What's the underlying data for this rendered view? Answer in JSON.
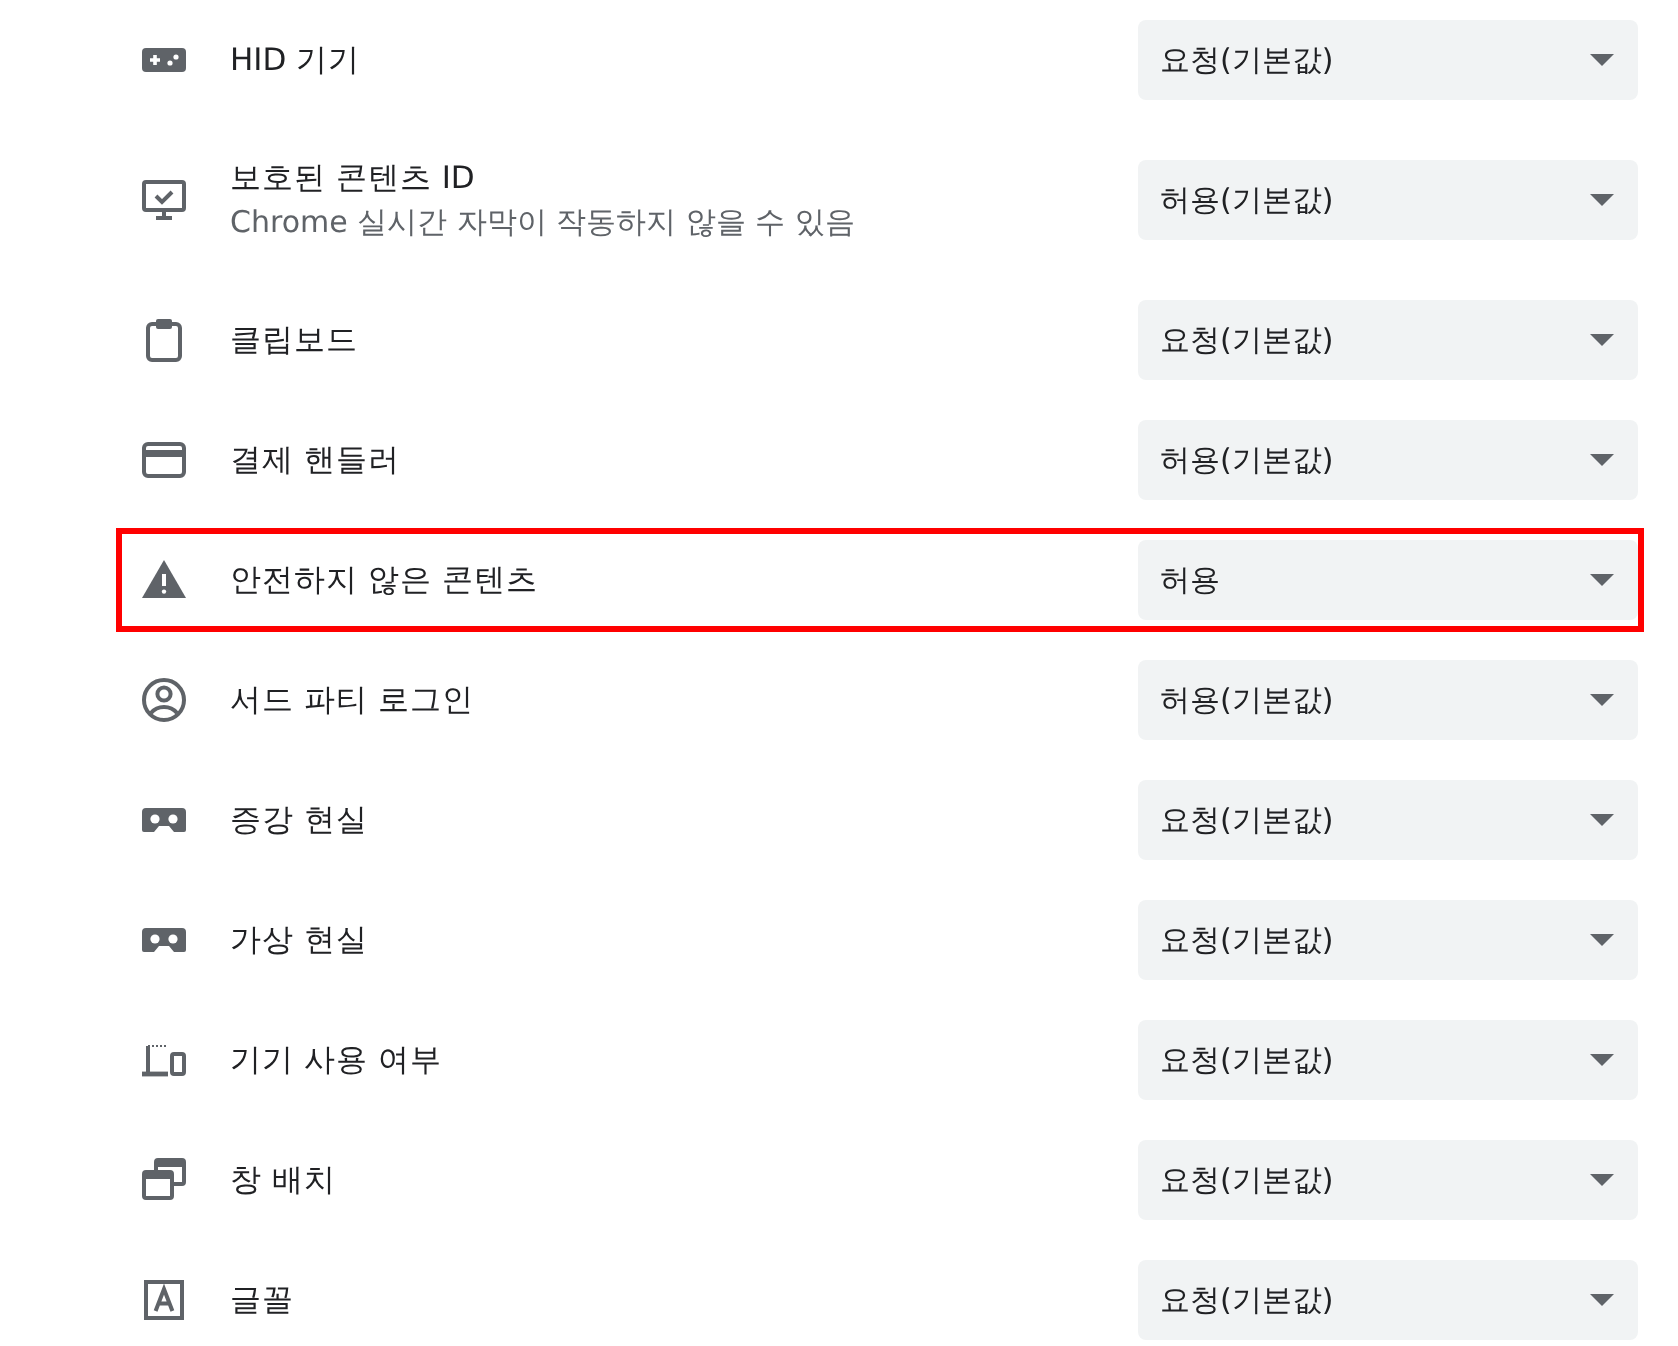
{
  "permissions": [
    {
      "kind": "hid",
      "label": "HID 기기",
      "value": "요청(기본값)",
      "highlighted": false
    },
    {
      "kind": "protected",
      "label": "보호된 콘텐츠 ID",
      "sublabel": "Chrome 실시간 자막이 작동하지 않을 수 있음",
      "value": "허용(기본값)",
      "highlighted": false
    },
    {
      "kind": "clipboard",
      "label": "클립보드",
      "value": "요청(기본값)",
      "highlighted": false
    },
    {
      "kind": "payment",
      "label": "결제 핸들러",
      "value": "허용(기본값)",
      "highlighted": false
    },
    {
      "kind": "insecure",
      "label": "안전하지 않은 콘텐츠",
      "value": "허용",
      "highlighted": true
    },
    {
      "kind": "login",
      "label": "서드 파티 로그인",
      "value": "허용(기본값)",
      "highlighted": false
    },
    {
      "kind": "ar",
      "label": "증강 현실",
      "value": "요청(기본값)",
      "highlighted": false
    },
    {
      "kind": "vr",
      "label": "가상 현실",
      "value": "요청(기본값)",
      "highlighted": false
    },
    {
      "kind": "usage",
      "label": "기기 사용 여부",
      "value": "요청(기본값)",
      "highlighted": false
    },
    {
      "kind": "windows",
      "label": "창 배치",
      "value": "요청(기본값)",
      "highlighted": false
    },
    {
      "kind": "fonts",
      "label": "글꼴",
      "value": "요청(기본값)",
      "highlighted": false
    }
  ]
}
